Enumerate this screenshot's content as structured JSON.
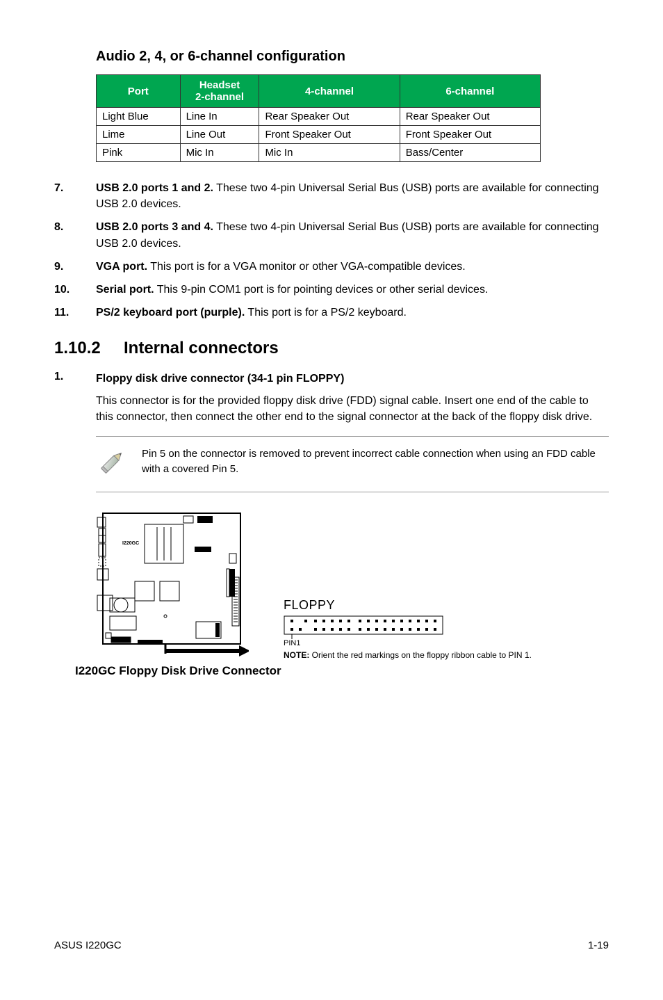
{
  "audio_section": {
    "title": "Audio 2, 4, or 6-channel configuration",
    "headers": {
      "port": "Port",
      "h2": "Headset\n2-channel",
      "h4": "4-channel",
      "h6": "6-channel"
    },
    "rows": [
      {
        "port": "Light Blue",
        "c2": "Line In",
        "c4": "Rear Speaker Out",
        "c6": "Rear Speaker Out"
      },
      {
        "port": "Lime",
        "c2": "Line Out",
        "c4": "Front Speaker Out",
        "c6": "Front Speaker Out"
      },
      {
        "port": "Pink",
        "c2": "Mic In",
        "c4": "Mic In",
        "c6": "Bass/Center"
      }
    ]
  },
  "items": {
    "i7": {
      "num": "7.",
      "lead": "USB 2.0 ports 1 and 2.",
      "text": " These two 4-pin Universal Serial Bus (USB) ports are available for connecting USB 2.0 devices."
    },
    "i8": {
      "num": "8.",
      "lead": "USB 2.0 ports 3 and 4.",
      "text": " These two 4-pin Universal Serial Bus (USB) ports are available for connecting USB 2.0 devices."
    },
    "i9": {
      "num": "9.",
      "lead": "VGA port.",
      "text": " This port is for a VGA monitor or other VGA-compatible devices."
    },
    "i10": {
      "num": "10.",
      "lead": "Serial port.",
      "text": " This 9-pin COM1 port is for pointing devices or other serial devices."
    },
    "i11": {
      "num": "11.",
      "lead": "PS/2 keyboard port (purple).",
      "text": " This port is for a PS/2 keyboard."
    }
  },
  "subsection": {
    "number": "1.10.2",
    "title": "Internal connectors"
  },
  "step1": {
    "num": "1.",
    "title": "Floppy disk drive connector (34-1 pin FLOPPY)",
    "text": "This connector is for the provided floppy disk drive (FDD) signal cable. Insert one end of the cable to this connector, then connect the other end to the signal connector at the back of the floppy disk drive."
  },
  "note": {
    "text": "Pin 5 on the connector is removed to prevent incorrect cable connection when using an FDD cable with a covered Pin 5."
  },
  "figure": {
    "board_label": "I220GC",
    "floppy_label": "FLOPPY",
    "pin_label": "PIN1",
    "note_lead": "NOTE:",
    "note_text": " Orient the red markings on the floppy ribbon cable to PIN 1.",
    "caption": "I220GC Floppy Disk Drive Connector"
  },
  "footer": {
    "left": "ASUS I220GC",
    "right": "1-19"
  }
}
